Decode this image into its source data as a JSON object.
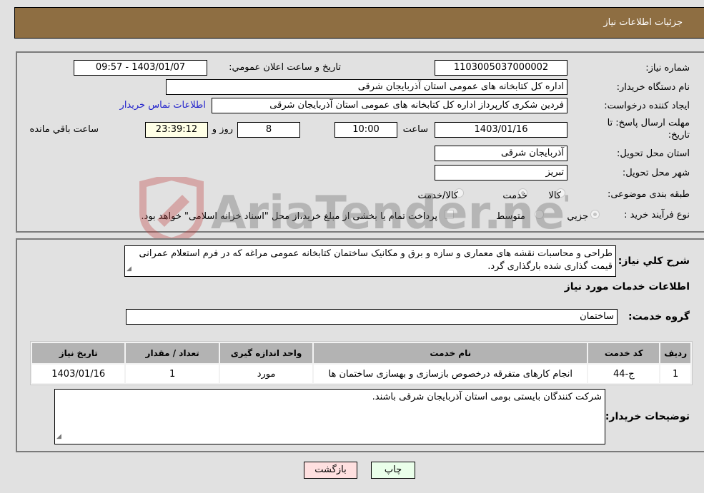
{
  "header": {
    "title": "جزئیات اطلاعات نیاز"
  },
  "info": {
    "need_number_label": "شماره نیاز:",
    "need_number": "1103005037000002",
    "announce_label": "تاريخ و ساعت اعلان عمومي:",
    "announce_value": "1403/01/07 - 09:57",
    "buyer_org_label": "نام دستگاه خریدار:",
    "buyer_org": "اداره کل کتابخانه های عمومی استان آذربایجان شرقی",
    "requester_label": "ایجاد کننده درخواست:",
    "requester": "فردین شکری کارپرداز اداره کل کتابخانه های عمومی استان آذربایجان شرقی",
    "contact_link": "اطلاعات تماس خریدار",
    "deadline_label_line1": "مهلت ارسال پاسخ: تا",
    "deadline_label_line2": "تاریخ:",
    "deadline_date": "1403/01/16",
    "hour_label": "ساعت",
    "deadline_hour": "10:00",
    "days_value": "8",
    "days_label": "روز و",
    "remaining_time": "23:39:12",
    "remaining_label": "ساعت باقي مانده",
    "province_label": "استان محل تحویل:",
    "province": "آذربایجان شرقی",
    "city_label": "شهر محل تحویل:",
    "city": "تبریز",
    "category_label": "طبقه بندی موضوعی:",
    "category_options": [
      {
        "label": "کالا",
        "checked": false
      },
      {
        "label": "خدمت",
        "checked": true
      },
      {
        "label": "کالا/خدمت",
        "checked": false
      }
    ],
    "process_label": "نوع فرآیند خرید :",
    "process_options": [
      {
        "label": "جزيي",
        "checked": true
      },
      {
        "label": "متوسط",
        "checked": false
      }
    ],
    "treasury_checkbox_label": "پرداخت تمام یا بخشی از مبلغ خرید،از محل \"اسناد خزانه اسلامی\" خواهد بود.",
    "treasury_checked": false
  },
  "details": {
    "summary_label": "شرح کلي نياز:",
    "summary": "طراحی و محاسبات نقشه های معماری و سازه و برق و مکانیک ساختمان کتابخانه عمومی مراغه که در فرم استعلام عمرانی قیمت گذاری شده بارگذاری گرد.",
    "services_heading": "اطلاعات خدمات مورد نیاز",
    "service_group_label": "گروه خدمت:",
    "service_group": "ساختمان",
    "table": {
      "headers": [
        "ردیف",
        "کد خدمت",
        "نام خدمت",
        "واحد اندازه گیری",
        "تعداد / مقدار",
        "تاریخ نیاز"
      ],
      "rows": [
        [
          "1",
          "ج-44",
          "انجام کارهای متفرقه درخصوص بازسازی و بهسازی ساختمان ها",
          "مورد",
          "1",
          "1403/01/16"
        ]
      ]
    },
    "buyer_notes_label": "توضیحات خریدار:",
    "buyer_notes": "شرکت کنندگان بایستی بومی استان آذربایجان شرقی باشند."
  },
  "buttons": {
    "print": "چاپ",
    "back": "بازگشت"
  },
  "watermark": {
    "text": "AriaTender.neT"
  }
}
